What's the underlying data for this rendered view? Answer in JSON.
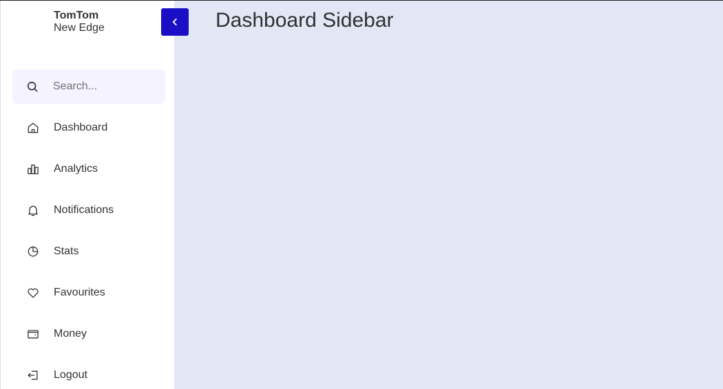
{
  "brand": {
    "name": "TomTom",
    "subtitle": "New Edge"
  },
  "toggle": {
    "icon": "chevron-left-icon",
    "color": "#1a0fc4"
  },
  "search": {
    "placeholder": "Search...",
    "value": "",
    "icon": "search-icon"
  },
  "nav": {
    "items": [
      {
        "label": "Dashboard",
        "icon": "home-icon"
      },
      {
        "label": "Analytics",
        "icon": "bar-chart-icon"
      },
      {
        "label": "Notifications",
        "icon": "bell-icon"
      },
      {
        "label": "Stats",
        "icon": "pie-chart-icon"
      },
      {
        "label": "Favourites",
        "icon": "heart-icon"
      },
      {
        "label": "Money",
        "icon": "wallet-icon"
      },
      {
        "label": "Logout",
        "icon": "logout-icon"
      }
    ]
  },
  "main": {
    "title": "Dashboard Sidebar",
    "background": "#e2e7f6"
  }
}
